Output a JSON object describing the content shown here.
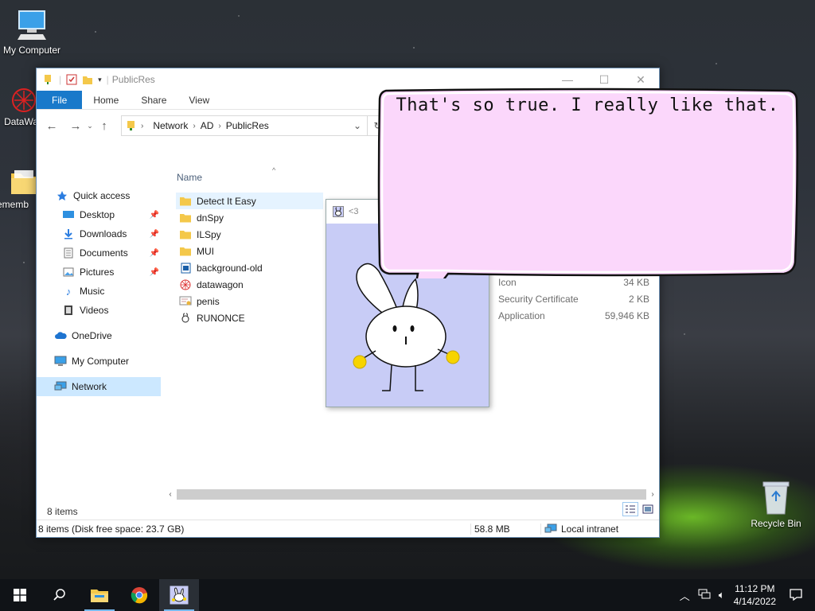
{
  "desktop": {
    "icons": [
      {
        "label": "My Computer"
      },
      {
        "label": "DataWa"
      },
      {
        "label": "rememb"
      }
    ],
    "recycle_bin": "Recycle Bin"
  },
  "explorer": {
    "title": "PublicRes",
    "ribbon_tabs": [
      "File",
      "Home",
      "Share",
      "View"
    ],
    "breadcrumb": [
      "Network",
      "AD",
      "PublicRes"
    ],
    "nav": [
      {
        "label": "Quick access",
        "icon": "star-icon"
      },
      {
        "label": "Desktop",
        "icon": "desktop-icon",
        "pinned": true
      },
      {
        "label": "Downloads",
        "icon": "download-icon",
        "pinned": true
      },
      {
        "label": "Documents",
        "icon": "documents-icon",
        "pinned": true
      },
      {
        "label": "Pictures",
        "icon": "pictures-icon",
        "pinned": true
      },
      {
        "label": "Music",
        "icon": "music-icon"
      },
      {
        "label": "Videos",
        "icon": "videos-icon"
      },
      {
        "label": "OneDrive",
        "icon": "cloud-icon"
      },
      {
        "label": "My Computer",
        "icon": "computer-icon"
      },
      {
        "label": "Network",
        "icon": "network-icon",
        "selected": true
      }
    ],
    "column_name": "Name",
    "files": [
      {
        "name": "Detect It Easy",
        "icon": "folder-icon"
      },
      {
        "name": "dnSpy",
        "icon": "folder-icon"
      },
      {
        "name": "ILSpy",
        "icon": "folder-icon"
      },
      {
        "name": "MUI",
        "icon": "folder-icon"
      },
      {
        "name": "background-old",
        "icon": "image-file-icon"
      },
      {
        "name": "datawagon",
        "icon": "datawagon-icon"
      },
      {
        "name": "penis",
        "icon": "certificate-icon"
      },
      {
        "name": "RUNONCE",
        "icon": "app-icon"
      }
    ],
    "details": [
      {
        "type": "Icon",
        "size": "34 KB"
      },
      {
        "type": "Security Certificate",
        "size": "2 KB"
      },
      {
        "type": "Application",
        "size": "59,946 KB"
      }
    ],
    "item_count": "8 items",
    "status": {
      "left": "8 items (Disk free space: 23.7 GB)",
      "size": "58.8 MB",
      "zone": "Local intranet"
    }
  },
  "popup": {
    "title": "<3"
  },
  "bubble": {
    "text": "That's so true. I really like that."
  },
  "taskbar": {
    "time": "11:12 PM",
    "date": "4/14/2022"
  },
  "colors": {
    "accent": "#1979ca",
    "bubble_fill": "#fbd7fb",
    "popup_bg": "#c8ccf6"
  }
}
